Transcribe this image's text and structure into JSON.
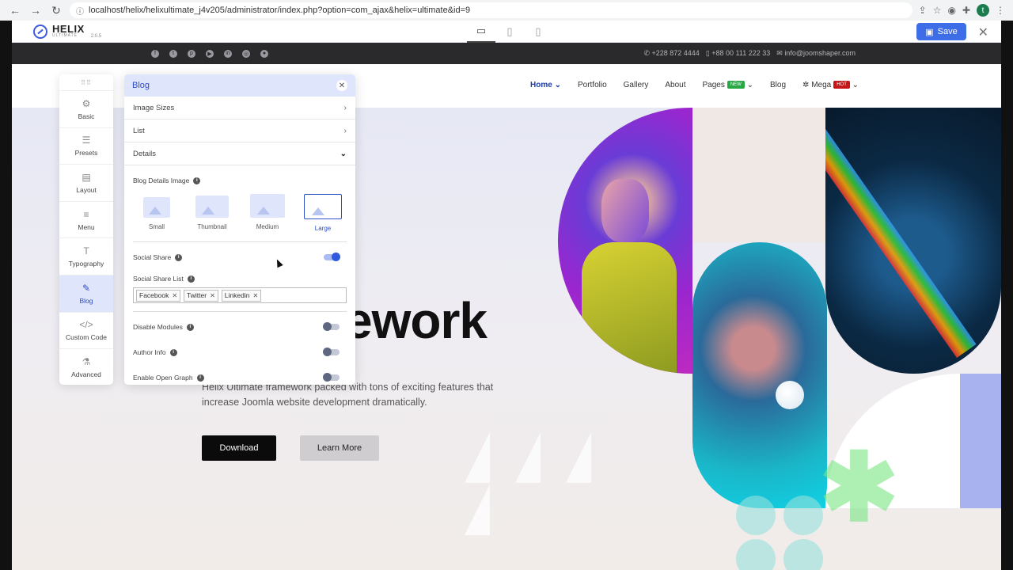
{
  "browser": {
    "url": "localhost/helix/helixultimate_j4v205/administrator/index.php?option=com_ajax&helix=ultimate&id=9",
    "profile_initial": "t"
  },
  "helix": {
    "logo_name": "HELIX",
    "logo_sub": "ULTIMATE",
    "version": "2.0.5",
    "save_label": "Save"
  },
  "topbar": {
    "phone1": "+228 872 4444",
    "phone2": "+88 00 111 222 33",
    "email": "info@joomshaper.com"
  },
  "nav": {
    "items": [
      "Home",
      "Portfolio",
      "Gallery",
      "About",
      "Pages",
      "Blog",
      "Mega"
    ],
    "badge_new": "NEW",
    "badge_hot": "HOT"
  },
  "hero": {
    "title": "ework",
    "desc_line1": "Helix Ultimate framework packed with tons of exciting features that",
    "desc_line2": "increase Joomla website development dramatically.",
    "download": "Download",
    "learn_more": "Learn More"
  },
  "sidebar": {
    "items": [
      "Basic",
      "Presets",
      "Layout",
      "Menu",
      "Typography",
      "Blog",
      "Custom Code",
      "Advanced"
    ]
  },
  "panel": {
    "title": "Blog",
    "sections": [
      "Image Sizes",
      "List",
      "Details"
    ],
    "blog_details_image": "Blog Details Image",
    "image_options": [
      "Small",
      "Thumbnail",
      "Medium",
      "Large"
    ],
    "social_share": "Social Share",
    "social_share_list": "Social Share List",
    "tags": [
      "Facebook",
      "Twitter",
      "Linkedin"
    ],
    "disable_modules": "Disable Modules",
    "author_info": "Author Info",
    "enable_open_graph": "Enable Open Graph"
  },
  "colors": {
    "accent": "#2f4fc5",
    "save": "#3d6ee8"
  }
}
